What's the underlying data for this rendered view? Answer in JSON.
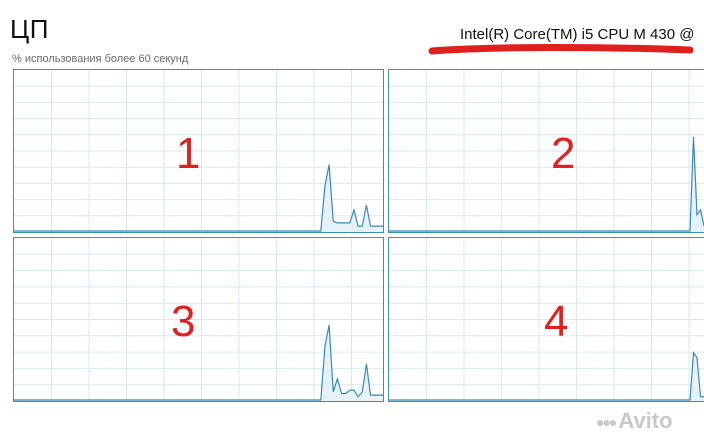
{
  "header": {
    "title": "ЦП",
    "subtitle": "% использования более 60 секунд",
    "cpu_name": "Intel(R) Core(TM) i5 CPU M 430 @"
  },
  "colors": {
    "graph_line": "#3a8ab8",
    "graph_fill": "#e6f1f8",
    "grid": "#d7e9f3",
    "border": "#3b8fb0",
    "annotation": "#e01f1f"
  },
  "panels": [
    {
      "label": "1",
      "usage": [
        0,
        0,
        0,
        0,
        0,
        0,
        0,
        0,
        0,
        0,
        0,
        0,
        0,
        0,
        0,
        0,
        0,
        0,
        0,
        0,
        0,
        0,
        0,
        0,
        0,
        0,
        0,
        0,
        0,
        0,
        0,
        0,
        0,
        0,
        0,
        0,
        0,
        0,
        0,
        0,
        0,
        0,
        0,
        0,
        0,
        0,
        0,
        0,
        0,
        0,
        0,
        0,
        0,
        0,
        0,
        0,
        0,
        0,
        0,
        0,
        0,
        0,
        0,
        0,
        0,
        0,
        0,
        0,
        0,
        0,
        0,
        0,
        0,
        0,
        0,
        28,
        41,
        6,
        5,
        5,
        5,
        5,
        13,
        3,
        3,
        16,
        3,
        3,
        3,
        3
      ]
    },
    {
      "label": "2",
      "usage": [
        0,
        0,
        0,
        0,
        0,
        0,
        0,
        0,
        0,
        0,
        0,
        0,
        0,
        0,
        0,
        0,
        0,
        0,
        0,
        0,
        0,
        0,
        0,
        0,
        0,
        0,
        0,
        0,
        0,
        0,
        0,
        0,
        0,
        0,
        0,
        0,
        0,
        0,
        0,
        0,
        0,
        0,
        0,
        0,
        0,
        0,
        0,
        0,
        0,
        0,
        0,
        0,
        0,
        0,
        0,
        0,
        0,
        0,
        0,
        0,
        0,
        0,
        0,
        0,
        0,
        0,
        0,
        0,
        0,
        0,
        0,
        0,
        0,
        0,
        0,
        0,
        0,
        0,
        0,
        0,
        0,
        0,
        0,
        0,
        0,
        0,
        0,
        58,
        10,
        13,
        3
      ]
    },
    {
      "label": "3",
      "usage": [
        0,
        0,
        0,
        0,
        0,
        0,
        0,
        0,
        0,
        0,
        0,
        0,
        0,
        0,
        0,
        0,
        0,
        0,
        0,
        0,
        0,
        0,
        0,
        0,
        0,
        0,
        0,
        0,
        0,
        0,
        0,
        0,
        0,
        0,
        0,
        0,
        0,
        0,
        0,
        0,
        0,
        0,
        0,
        0,
        0,
        0,
        0,
        0,
        0,
        0,
        0,
        0,
        0,
        0,
        0,
        0,
        0,
        0,
        0,
        0,
        0,
        0,
        0,
        0,
        0,
        0,
        0,
        0,
        0,
        0,
        0,
        0,
        0,
        0,
        0,
        33,
        46,
        5,
        13,
        4,
        4,
        6,
        6,
        2,
        5,
        22,
        3,
        3,
        3,
        3
      ]
    },
    {
      "label": "4",
      "usage": [
        0,
        0,
        0,
        0,
        0,
        0,
        0,
        0,
        0,
        0,
        0,
        0,
        0,
        0,
        0,
        0,
        0,
        0,
        0,
        0,
        0,
        0,
        0,
        0,
        0,
        0,
        0,
        0,
        0,
        0,
        0,
        0,
        0,
        0,
        0,
        0,
        0,
        0,
        0,
        0,
        0,
        0,
        0,
        0,
        0,
        0,
        0,
        0,
        0,
        0,
        0,
        0,
        0,
        0,
        0,
        0,
        0,
        0,
        0,
        0,
        0,
        0,
        0,
        0,
        0,
        0,
        0,
        0,
        0,
        0,
        0,
        0,
        0,
        0,
        0,
        0,
        0,
        0,
        0,
        0,
        0,
        0,
        0,
        0,
        0,
        0,
        0,
        29,
        26,
        2,
        2
      ]
    }
  ],
  "watermark": {
    "text": "Avito"
  }
}
